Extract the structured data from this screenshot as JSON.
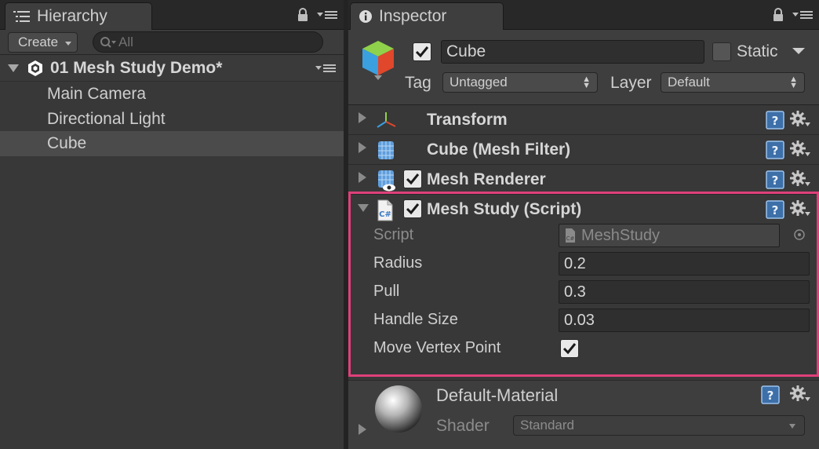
{
  "hierarchy": {
    "tab_title": "Hierarchy",
    "create_label": "Create",
    "search_placeholder": "All",
    "scene_name": "01 Mesh Study Demo*",
    "items": [
      {
        "label": "Main Camera",
        "selected": false
      },
      {
        "label": "Directional Light",
        "selected": false
      },
      {
        "label": "Cube",
        "selected": true
      }
    ]
  },
  "inspector": {
    "tab_title": "Inspector",
    "object_name": "Cube",
    "active": true,
    "static_label": "Static",
    "static": false,
    "tag_label": "Tag",
    "tag_value": "Untagged",
    "layer_label": "Layer",
    "layer_value": "Default",
    "components": [
      {
        "title": "Transform",
        "expanded": false,
        "has_checkbox": false
      },
      {
        "title": "Cube (Mesh Filter)",
        "expanded": false,
        "has_checkbox": false
      },
      {
        "title": "Mesh Renderer",
        "expanded": false,
        "has_checkbox": true,
        "checked": true
      },
      {
        "title": "Mesh Study (Script)",
        "expanded": true,
        "has_checkbox": true,
        "checked": true
      }
    ],
    "script_props": {
      "script_label": "Script",
      "script_value": "MeshStudy",
      "radius_label": "Radius",
      "radius_value": "0.2",
      "pull_label": "Pull",
      "pull_value": "0.3",
      "handle_label": "Handle Size",
      "handle_value": "0.03",
      "move_label": "Move Vertex Point",
      "move_checked": true
    },
    "material": {
      "name": "Default-Material",
      "shader_label": "Shader",
      "shader_value": "Standard"
    }
  },
  "colors": {
    "highlight": "#e0407a",
    "panel_bg": "#383838",
    "selection_bg": "#4b4b4b"
  }
}
